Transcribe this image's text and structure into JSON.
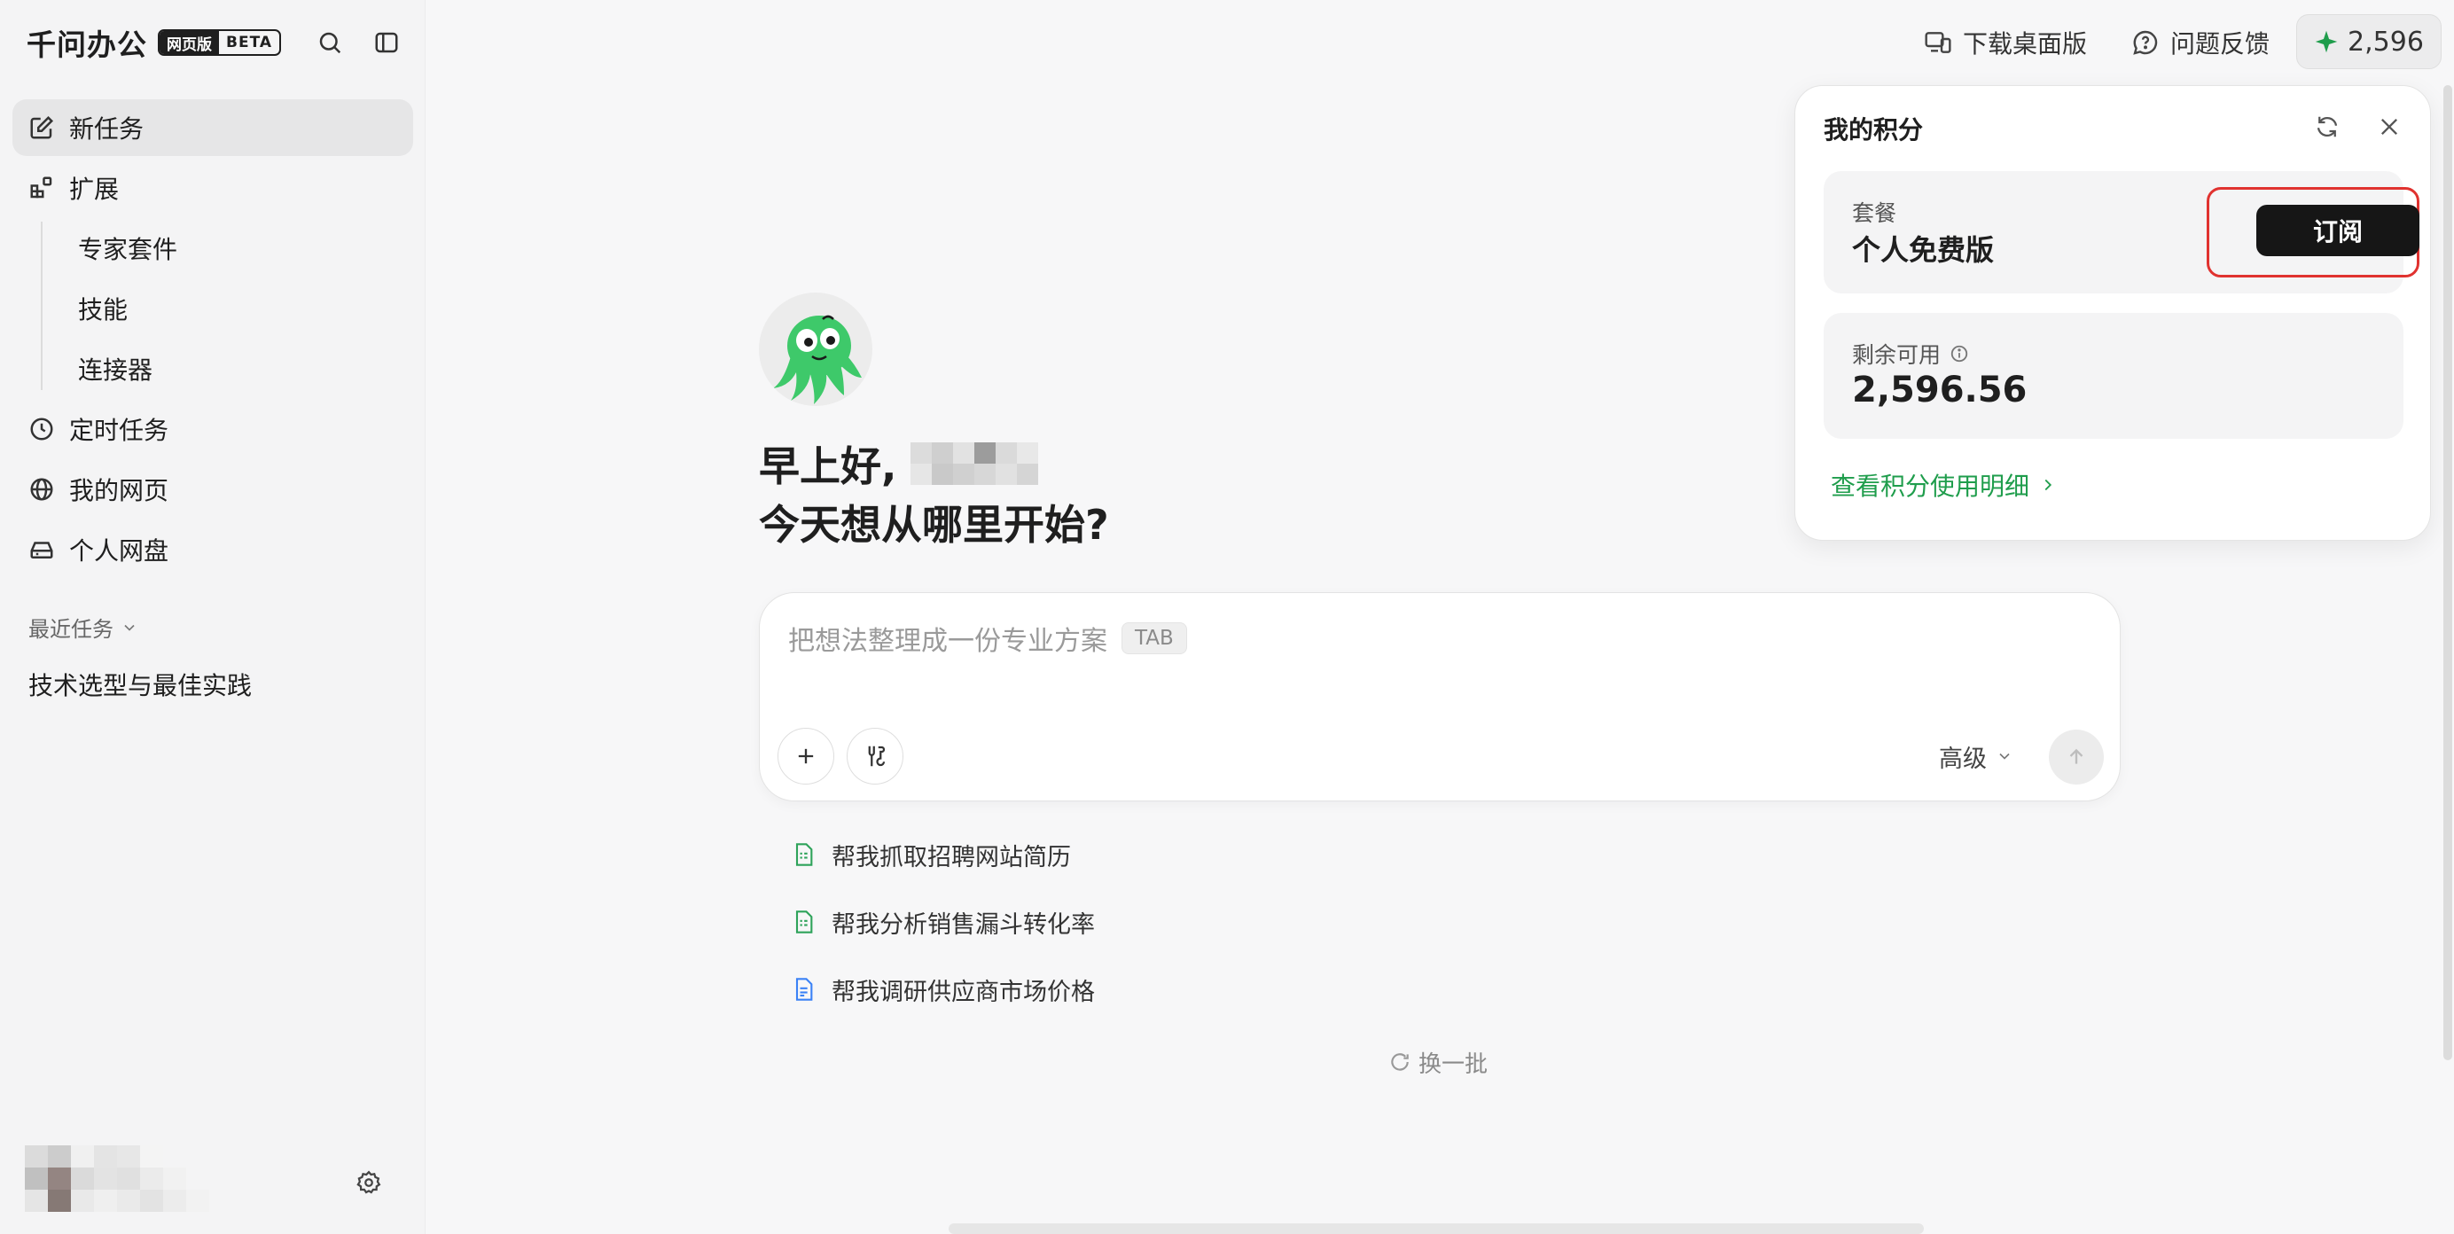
{
  "brand": {
    "name": "千问办公",
    "badge_web": "网页版",
    "badge_beta": "BETA"
  },
  "sidebar": {
    "items": [
      {
        "label": "新任务",
        "icon": "edit-icon"
      },
      {
        "label": "扩展",
        "icon": "extension-icon"
      },
      {
        "label": "定时任务",
        "icon": "clock-icon"
      },
      {
        "label": "我的网页",
        "icon": "globe-icon"
      },
      {
        "label": "个人网盘",
        "icon": "drive-icon"
      }
    ],
    "sub_items": [
      {
        "label": "专家套件"
      },
      {
        "label": "技能"
      },
      {
        "label": "连接器"
      }
    ],
    "recent_label": "最近任务",
    "recent": [
      {
        "label": "技术选型与最佳实践"
      }
    ]
  },
  "topbar": {
    "download_label": "下载桌面版",
    "feedback_label": "问题反馈",
    "credits": "2,596"
  },
  "main": {
    "greeting": "早上好,",
    "question": "今天想从哪里开始?",
    "placeholder": "把想法整理成一份专业方案",
    "tab_hint": "TAB",
    "advanced_label": "高级",
    "suggestions": [
      {
        "label": "帮我抓取招聘网站简历",
        "icon": "spreadsheet-icon",
        "color": "#2ea35a"
      },
      {
        "label": "帮我分析销售漏斗转化率",
        "icon": "spreadsheet-icon",
        "color": "#2ea35a"
      },
      {
        "label": "帮我调研供应商市场价格",
        "icon": "document-icon",
        "color": "#3b82f6"
      }
    ],
    "refresh_label": "换一批"
  },
  "popover": {
    "title": "我的积分",
    "plan_label": "套餐",
    "plan_name": "个人免费版",
    "subscribe_label": "订阅",
    "remaining_label": "剩余可用",
    "remaining_value": "2,596.56",
    "detail_link": "查看积分使用明细"
  },
  "colors": {
    "accent_green": "#1f9d4c",
    "highlight_red": "#e0322f",
    "mascot_green": "#3ec96a"
  }
}
